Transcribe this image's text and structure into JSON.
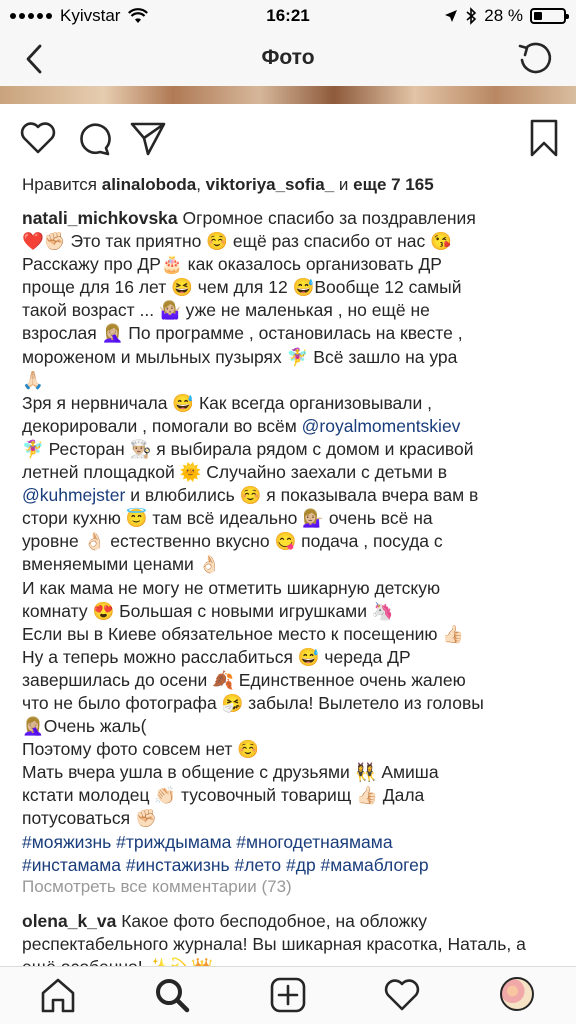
{
  "status": {
    "carrier": "Kyivstar",
    "time": "16:21",
    "battery": "28 %",
    "battery_level": 0.28,
    "icons": [
      "signal-dots",
      "wifi-icon",
      "location-arrow-icon",
      "bluetooth-icon",
      "battery-icon"
    ]
  },
  "nav": {
    "title": "Фото",
    "back_icon": "chevron-left-icon",
    "refresh_icon": "refresh-icon"
  },
  "actions": [
    "heart-icon",
    "comment-icon",
    "share-icon",
    "bookmark-icon"
  ],
  "likes": {
    "prefix": "Нравится ",
    "user1": "alinaloboda",
    "sep": ", ",
    "user2": "viktoriya_sofia_",
    "and": " и ",
    "more": "еще 7 165"
  },
  "caption": {
    "username": "natali_michkovska",
    "lines": [
      " Огромное спасибо за поздравления",
      "❤️✊🏻 Это так приятно ☺️ ещё раз спасибо от нас 😘",
      "Расскажу про ДР🎂 как оказалось организовать ДР",
      "проще для 16 лет 😆 чем для 12 😅Вообще 12 самый",
      "такой возраст ... 🤷🏼‍♀️ уже не маленькая , но ещё не",
      "взрослая 🤦🏼‍♀️ По программе , остановилась на квесте ,",
      "мороженом и мыльных пузырях 🧚‍♀️ Всё зашло на ура",
      "🙏🏻",
      "Зря я нервничала 😅 Как всегда организовывали ,",
      "декорировали , помогали во всём ",
      "🧚‍♀️ Ресторан 👨🏼‍🍳 я выбирала рядом с домом и красивой",
      "летней площадкой 🌞 Случайно заехали с детьми в",
      " и влюбились ☺️ я показывала вчера вам в",
      "стори кухню 😇 там всё идеально 💁🏼‍♀️ очень всё на",
      "уровне 👌🏻 естественно вкусно 😋 подача , посуда с",
      "вменяемыми ценами 👌🏻",
      "И как мама не могу не отметить шикарную детскую",
      "комнату 😍 Большая с новыми игрушками 🦄",
      "Если вы в Киеве обязательное место к посещению 👍🏻",
      "Ну а теперь можно расслабиться 😅 череда ДР",
      "завершилась до осени 🍂 Единственное очень жалею",
      "что не было фотографа 🤧 забыла! Вылетело из головы",
      "🤦🏼‍♀️Очень жаль(",
      " Поэтому фото совсем нет ☺️",
      " Мать вчера ушла в общение с друзьями 👯‍♀️ Амиша",
      "кстати молодец 👏🏻 тусовочный товарищ 👍🏻 Дала",
      "потусоваться ✊🏻"
    ],
    "mentions": [
      "@royalmomentskiev",
      "@kuhmejster"
    ],
    "hashtags": [
      "#мояжизнь #триждымама #многодетнаямама",
      "#инстамама #инстажизнь #лето #др #мамаблогер"
    ]
  },
  "view_comments": "Посмотреть все комментарии (73)",
  "comment": {
    "username": "olena_k_va",
    "text": " Какое фото бесподобное, на обложку респектабельного журнала! Вы шикарная красотка, Наталь, а ещё особенно! ✨💫👑"
  },
  "tabbar": [
    "home-icon",
    "search-icon",
    "add-post-icon",
    "activity-heart-icon",
    "profile-avatar"
  ],
  "colors": {
    "link": "#1a3d7c",
    "muted": "#999999",
    "text": "#262626",
    "bar": "#f7f7f7"
  }
}
